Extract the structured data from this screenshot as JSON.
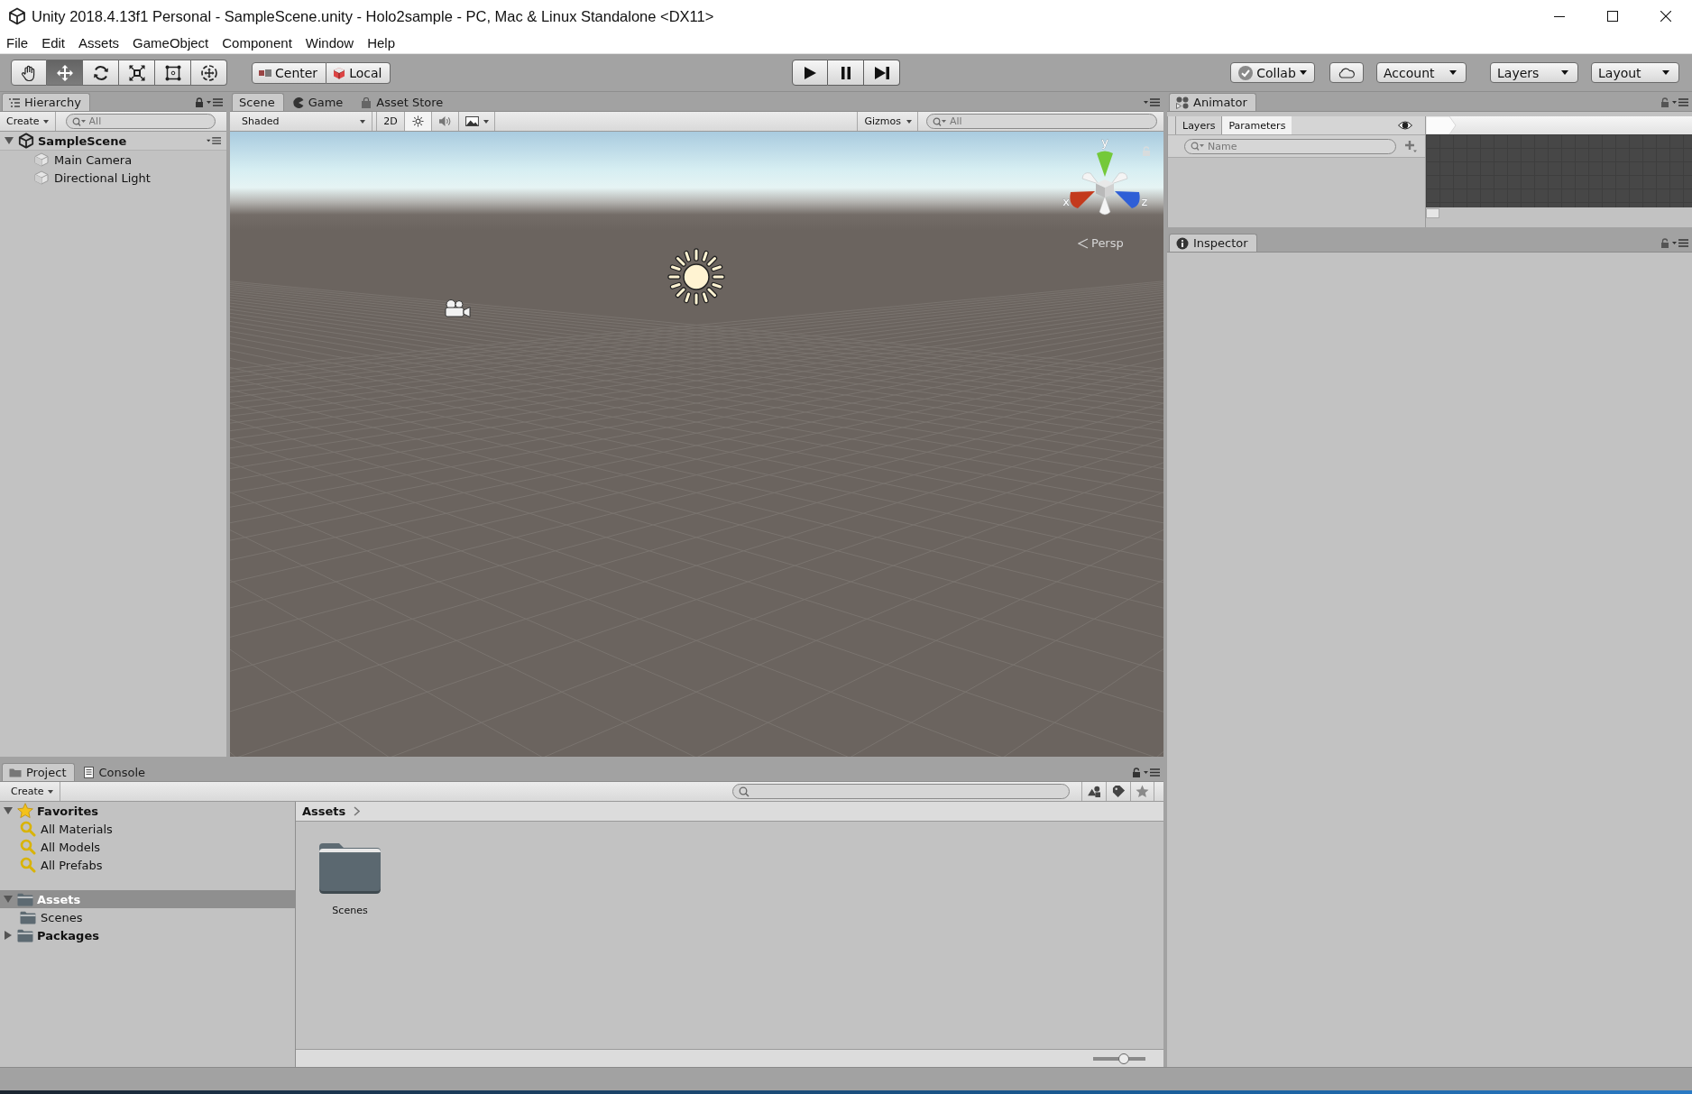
{
  "window": {
    "title": "Unity 2018.4.13f1 Personal - SampleScene.unity - Holo2sample - PC, Mac & Linux Standalone <DX11>"
  },
  "menu": [
    "File",
    "Edit",
    "Assets",
    "GameObject",
    "Component",
    "Window",
    "Help"
  ],
  "toolbar": {
    "tools": [
      {
        "kind": "hand",
        "selected": false
      },
      {
        "kind": "move",
        "selected": true
      },
      {
        "kind": "rotate",
        "selected": false
      },
      {
        "kind": "scale",
        "selected": false
      },
      {
        "kind": "rect",
        "selected": false
      },
      {
        "kind": "transform",
        "selected": false
      }
    ],
    "pivot": [
      {
        "kind": "position",
        "label": "Center"
      },
      {
        "kind": "rotation",
        "label": "Local"
      }
    ],
    "playback": [
      {
        "kind": "play"
      },
      {
        "kind": "pause"
      },
      {
        "kind": "step"
      }
    ],
    "services": [
      {
        "kind": "collab",
        "label": "Collab"
      },
      {
        "kind": "cloud"
      },
      {
        "kind": "dropdown",
        "label": "Account"
      }
    ],
    "dropdowns": [
      {
        "label": "Layers"
      },
      {
        "label": "Layout"
      }
    ]
  },
  "hierarchy": {
    "tab": "Hierarchy",
    "create": "Create",
    "search": {
      "placeholder": "All"
    },
    "scene": {
      "name": "SampleScene",
      "expanded": true,
      "children": [
        {
          "name": "Main Camera"
        },
        {
          "name": "Directional Light"
        }
      ]
    }
  },
  "scene_view": {
    "tabs": [
      {
        "kind": "scene",
        "label": "Scene",
        "selected": true
      },
      {
        "kind": "game",
        "label": "Game",
        "selected": false
      },
      {
        "kind": "store",
        "label": "Asset Store",
        "selected": false
      }
    ],
    "shading": "Shaded",
    "toggles": [
      {
        "kind": "dimension",
        "label": "2D",
        "on": false
      },
      {
        "kind": "lighting",
        "on": true
      },
      {
        "kind": "audio",
        "on": false
      },
      {
        "kind": "effects",
        "on": false
      }
    ],
    "gizmos": "Gizmos",
    "search": {
      "placeholder": "All"
    },
    "gizmo_axes": [
      {
        "label": "y",
        "color": "#74c93a"
      },
      {
        "label": "x",
        "color": "#c33a1d"
      },
      {
        "label": "z",
        "color": "#2f5fd6"
      }
    ],
    "projection": "Persp"
  },
  "animator": {
    "tab": "Animator",
    "tabs": [
      {
        "label": "Layers",
        "selected": false
      },
      {
        "label": "Parameters",
        "selected": true
      }
    ],
    "search": {
      "placeholder": "Name"
    }
  },
  "inspector": {
    "tab": "Inspector"
  },
  "project": {
    "tabs": [
      {
        "kind": "project",
        "label": "Project",
        "selected": true
      },
      {
        "kind": "console",
        "label": "Console",
        "selected": false
      }
    ],
    "create": "Create",
    "tree": [
      {
        "kind": "favorites",
        "label": "Favorites",
        "expanded": true,
        "selected": false,
        "children": [
          {
            "kind": "search",
            "label": "All Materials",
            "selected": false
          },
          {
            "kind": "search",
            "label": "All Models",
            "selected": false
          },
          {
            "kind": "search",
            "label": "All Prefabs",
            "selected": false
          }
        ]
      },
      {
        "kind": "folder",
        "label": "Assets",
        "expanded": true,
        "selected": true,
        "children": [
          {
            "kind": "folder",
            "label": "Scenes",
            "selected": false
          }
        ]
      },
      {
        "kind": "folder",
        "label": "Packages",
        "expanded": false,
        "selected": false
      }
    ],
    "breadcrumb": [
      {
        "label": "Assets"
      }
    ],
    "items": [
      {
        "kind": "folder",
        "label": "Scenes"
      }
    ],
    "zoom_slider": {
      "level": 0.58
    }
  }
}
